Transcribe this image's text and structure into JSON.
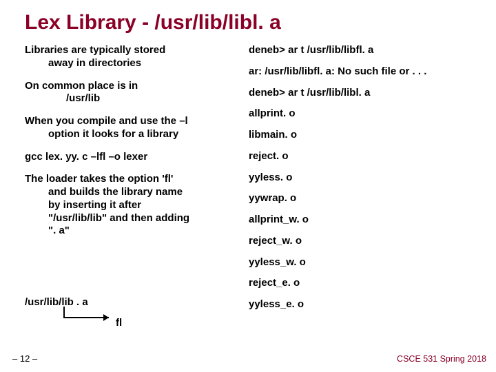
{
  "title": "Lex Library - /usr/lib/libl. a",
  "left": {
    "p1a": "Libraries are typically stored",
    "p1b": "away in directories",
    "p2a": "On common place is in",
    "p2b": "/usr/lib",
    "p3a": "When you compile and use the –l",
    "p3b": "option it looks for a library",
    "p4": "gcc lex. yy. c –lfl –o lexer",
    "p5a": "The loader takes the option 'fl'",
    "p5b": "and builds the library name",
    "p5c": "by inserting it after",
    "p5d": "\"/usr/lib/lib\" and then adding",
    "p5e": "\". a\"",
    "libpath": "/usr/lib/lib . a",
    "fl": "fl"
  },
  "right": {
    "l1": "deneb> ar t  /usr/lib/libfl. a",
    "l2": "ar: /usr/lib/libfl. a: No such file or . . .",
    "l3": "deneb> ar t  /usr/lib/libl. a",
    "l4": "allprint. o",
    "l5": "libmain. o",
    "l6": "reject. o",
    "l7": "yyless. o",
    "l8": "yywrap. o",
    "l9": "allprint_w. o",
    "l10": "reject_w. o",
    "l11": "yyless_w. o",
    "l12": "reject_e. o",
    "l13": "yyless_e. o"
  },
  "page": "– 12 –",
  "course": "CSCE 531 Spring 2018"
}
